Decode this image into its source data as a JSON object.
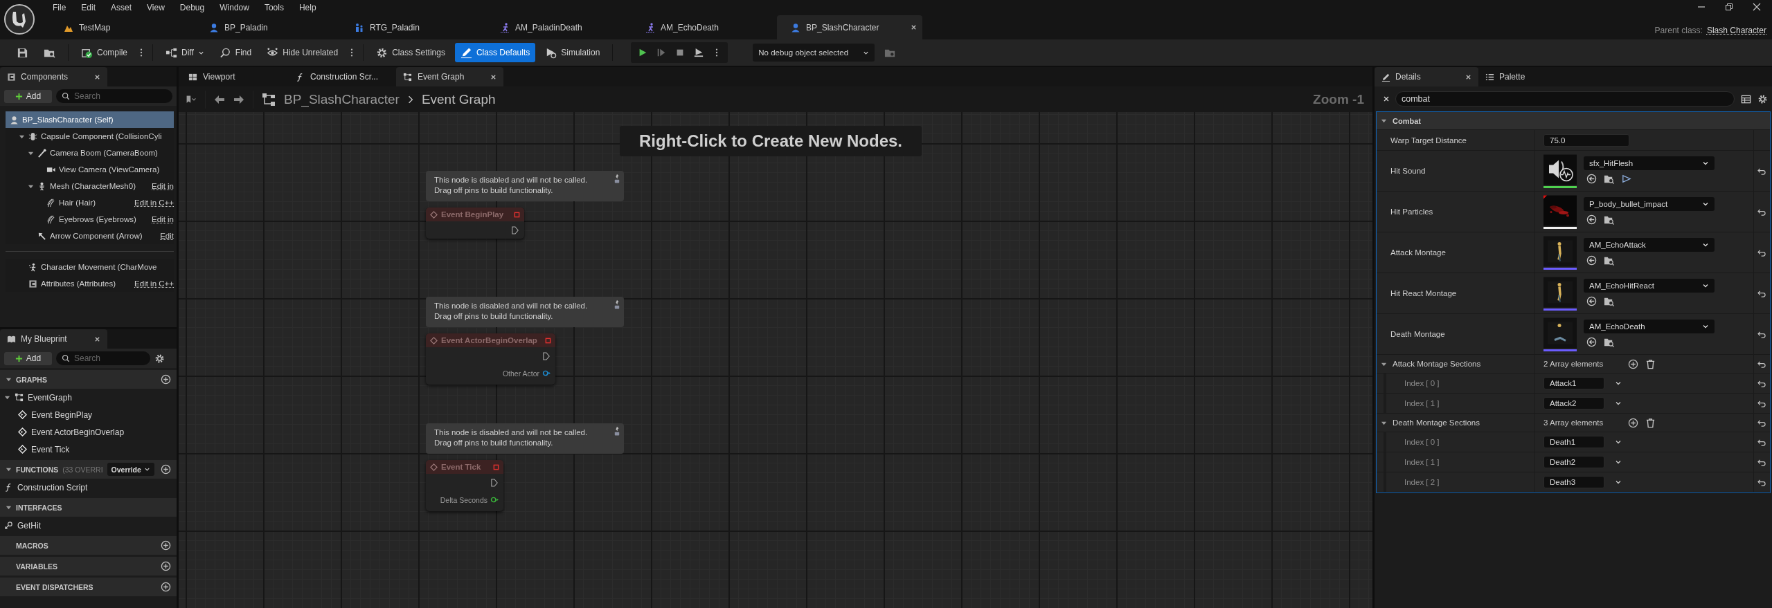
{
  "menu": [
    "File",
    "Edit",
    "Asset",
    "View",
    "Debug",
    "Window",
    "Tools",
    "Help"
  ],
  "document_tabs": [
    {
      "label": "TestMap",
      "kind": "map",
      "selected": false
    },
    {
      "label": "BP_Paladin",
      "kind": "blueprint",
      "selected": false
    },
    {
      "label": "RTG_Paladin",
      "kind": "retarget",
      "selected": false
    },
    {
      "label": "AM_PaladinDeath",
      "kind": "montage",
      "selected": false
    },
    {
      "label": "AM_EchoDeath",
      "kind": "montage",
      "selected": false
    },
    {
      "label": "BP_SlashCharacter",
      "kind": "blueprint",
      "selected": true
    }
  ],
  "parent_class": {
    "label": "Parent class:",
    "value": "Slash Character"
  },
  "toolbar": [
    {
      "label": "Compile",
      "kind": "compile",
      "more": true,
      "selected": false
    },
    {
      "label": "Diff",
      "kind": "diff",
      "more": false,
      "selected": false
    },
    {
      "label": "Find",
      "kind": "find",
      "more": false,
      "selected": false
    },
    {
      "label": "Hide Unrelated",
      "kind": "hide",
      "more": true,
      "selected": false
    },
    {
      "label": "Class Settings",
      "kind": "settings",
      "more": false,
      "selected": false
    },
    {
      "label": "Class Defaults",
      "kind": "defaults",
      "more": false,
      "selected": true
    },
    {
      "label": "Simulation",
      "kind": "simulation",
      "more": false,
      "selected": false
    }
  ],
  "debug_selector": {
    "value": "No debug object selected"
  },
  "components": {
    "title": "Components",
    "add": "Add",
    "search": {
      "placeholder": "Search"
    },
    "tree": [
      {
        "label": "BP_SlashCharacter (Self)",
        "kind": "self",
        "selected": true,
        "children": [
          {
            "label": "Capsule Component (CollisionCyli",
            "kind": "capsule",
            "selected": false,
            "expanded": true,
            "children": [
              {
                "label": "Camera Boom (CameraBoom)",
                "kind": "boom",
                "selected": false,
                "expanded": true,
                "children": [
                  {
                    "label": "View Camera (ViewCamera)",
                    "kind": "camera",
                    "selected": false
                  }
                ]
              },
              {
                "label": "Mesh (CharacterMesh0)",
                "kind": "mesh",
                "selected": false,
                "expanded": true,
                "edit": "Edit in",
                "children": [
                  {
                    "label": "Hair (Hair)",
                    "kind": "groom",
                    "selected": false,
                    "edit": "Edit in C++"
                  },
                  {
                    "label": "Eyebrows (Eyebrows)",
                    "kind": "groom",
                    "selected": false,
                    "edit": "Edit in"
                  }
                ]
              },
              {
                "label": "Arrow Component (Arrow)",
                "kind": "arrow",
                "selected": false,
                "edit": "Edit"
              }
            ]
          }
        ]
      }
    ],
    "other": [
      {
        "label": "Character Movement (CharMove",
        "kind": "movement",
        "selected": false
      },
      {
        "label": "Attributes (Attributes)",
        "kind": "attributes",
        "selected": false,
        "edit": "Edit in C++"
      }
    ]
  },
  "my_blueprint": {
    "title": "My Blueprint",
    "add": "Add",
    "search": {
      "placeholder": "Search"
    },
    "sections": [
      {
        "title": "GRAPHS",
        "expanded": true,
        "can_add": true,
        "items": [
          {
            "label": "EventGraph",
            "kind": "graph",
            "expanded": true,
            "children": [
              {
                "label": "Event BeginPlay",
                "kind": "event"
              },
              {
                "label": "Event ActorBeginOverlap",
                "kind": "event"
              },
              {
                "label": "Event Tick",
                "kind": "event"
              }
            ]
          }
        ]
      },
      {
        "title": "FUNCTIONS",
        "note": "(33 OVERRI",
        "override": "Override",
        "expanded": true,
        "can_add": true,
        "items": [
          {
            "label": "Construction Script",
            "kind": "function"
          }
        ]
      },
      {
        "title": "INTERFACES",
        "expanded": true,
        "can_add": false,
        "items": [
          {
            "label": "GetHit",
            "kind": "interface"
          }
        ]
      },
      {
        "title": "MACROS",
        "can_add": true
      },
      {
        "title": "VARIABLES",
        "can_add": true
      },
      {
        "title": "EVENT DISPATCHERS",
        "can_add": true
      }
    ]
  },
  "graph": {
    "tabs": [
      {
        "label": "Viewport",
        "kind": "viewport",
        "selected": false,
        "closable": false
      },
      {
        "label": "Construction Scr...",
        "kind": "function",
        "selected": false,
        "closable": false
      },
      {
        "label": "Event Graph",
        "kind": "graph",
        "selected": true,
        "closable": true
      }
    ],
    "breadcrumb": [
      "BP_SlashCharacter",
      "Event Graph"
    ],
    "zoom": "Zoom -1",
    "hint": "Right-Click to Create New Nodes.",
    "nodes": [
      {
        "comment": "This node is disabled and will not be called.\nDrag off pins to build functionality.",
        "title": "Event BeginPlay",
        "disabled": true
      },
      {
        "comment": "This node is disabled and will not be called.\nDrag off pins to build functionality.",
        "title": "Event ActorBeginOverlap",
        "disabled": true,
        "pins": [
          {
            "label": "Other Actor",
            "kind": "object"
          }
        ]
      },
      {
        "comment": "This node is disabled and will not be called.\nDrag off pins to build functionality.",
        "title": "Event Tick",
        "disabled": true,
        "pins": [
          {
            "label": "Delta Seconds",
            "kind": "float"
          }
        ]
      }
    ]
  },
  "details": {
    "tabs": [
      {
        "label": "Details",
        "kind": "details",
        "selected": true,
        "closable": true
      },
      {
        "label": "Palette",
        "kind": "palette",
        "selected": false,
        "closable": false
      }
    ],
    "search": {
      "value": "combat"
    },
    "category": {
      "label": "Combat",
      "expanded": true
    },
    "properties": [
      {
        "kind": "number",
        "label": "Warp Target Distance",
        "value": "75.0",
        "reset": false
      },
      {
        "kind": "sound_asset",
        "label": "Hit Sound",
        "value": "sfx_HitFlesh",
        "reset": true
      },
      {
        "kind": "particle_asset",
        "label": "Hit Particles",
        "value": "P_body_bullet_impact",
        "reset": true
      },
      {
        "kind": "montage_asset",
        "label": "Attack Montage",
        "value": "AM_EchoAttack",
        "reset": true
      },
      {
        "kind": "montage_asset",
        "label": "Hit React Montage",
        "value": "AM_EchoHitReact",
        "reset": true
      },
      {
        "kind": "montage_asset",
        "label": "Death Montage",
        "value": "AM_EchoDeath",
        "reset": true
      },
      {
        "kind": "array",
        "label": "Attack Montage Sections",
        "count": "2 Array elements",
        "expanded": true,
        "reset": true,
        "elements": [
          {
            "label": "Index [ 0 ]",
            "value": "Attack1",
            "reset": true
          },
          {
            "label": "Index [ 1 ]",
            "value": "Attack2",
            "reset": true
          }
        ]
      },
      {
        "kind": "array",
        "label": "Death Montage Sections",
        "count": "3 Array elements",
        "expanded": true,
        "reset": true,
        "elements": [
          {
            "label": "Index [ 0 ]",
            "value": "Death1",
            "reset": true
          },
          {
            "label": "Index [ 1 ]",
            "value": "Death2",
            "reset": true
          },
          {
            "label": "Index [ 2 ]",
            "value": "Death3",
            "reset": true
          }
        ]
      }
    ]
  }
}
